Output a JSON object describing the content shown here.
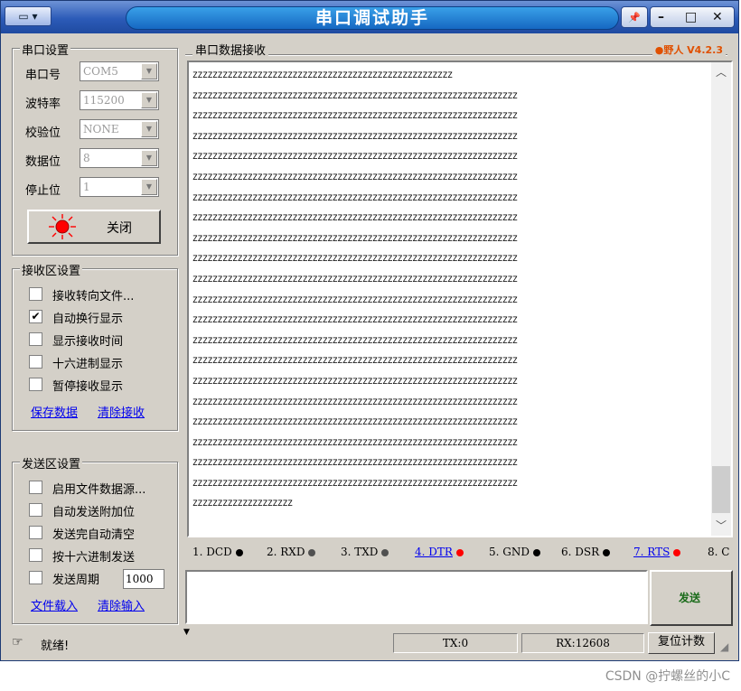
{
  "window": {
    "title": "串口调试助手",
    "sysmenu_icon": "window-menu-icon",
    "controls": {
      "pin": "📌",
      "minimize": "–",
      "maximize": "□",
      "close": "✕"
    }
  },
  "serial_settings": {
    "title": "串口设置",
    "fields": [
      {
        "label": "串口号",
        "value": "COM5"
      },
      {
        "label": "波特率",
        "value": "115200"
      },
      {
        "label": "校验位",
        "value": "NONE"
      },
      {
        "label": "数据位",
        "value": "8"
      },
      {
        "label": "停止位",
        "value": "1"
      }
    ],
    "open_button": "关闭",
    "indicator_color": "#ff0000"
  },
  "receive_settings": {
    "title": "接收区设置",
    "options": [
      {
        "label": "接收转向文件...",
        "checked": false
      },
      {
        "label": "自动换行显示",
        "checked": true
      },
      {
        "label": "显示接收时间",
        "checked": false
      },
      {
        "label": "十六进制显示",
        "checked": false
      },
      {
        "label": "暂停接收显示",
        "checked": false
      }
    ],
    "save_link": "保存数据",
    "clear_link": "清除接收"
  },
  "send_settings": {
    "title": "发送区设置",
    "options": [
      {
        "label": "启用文件数据源...",
        "checked": false
      },
      {
        "label": "自动发送附加位",
        "checked": false
      },
      {
        "label": "发送完自动清空",
        "checked": false
      },
      {
        "label": "按十六进制发送",
        "checked": false
      },
      {
        "label": "发送周期",
        "checked": false
      }
    ],
    "period_value": "1000",
    "load_link": "文件载入",
    "clear_link": "清除输入"
  },
  "receive_area": {
    "title": "串口数据接收",
    "brand": "●野人 V4.2.3",
    "brand_color": "#e05000",
    "first_line": "ZZZZZZZZZZZZZZZZZZZZZZZZZZZZZZZZZZZZZZZZZZZZZZZZZZZZ",
    "full_line": "ZZZZZZZZZZZZZZZZZZZZZZZZZZZZZZZZZZZZZZZZZZZZZZZZZZZZZZZZZZZZZZZZZ",
    "full_line_count": 20,
    "last_line": "ZZZZZZZZZZZZZZZZZZZZ"
  },
  "signals": [
    {
      "label": "1. DCD",
      "dot": "#000000",
      "link": false
    },
    {
      "label": "2. RXD",
      "dot": "#505050",
      "link": false
    },
    {
      "label": "3. TXD",
      "dot": "#505050",
      "link": false
    },
    {
      "label": "4. DTR",
      "dot": "#ff0000",
      "link": true
    },
    {
      "label": "5. GND",
      "dot": "#000000",
      "link": false
    },
    {
      "label": "6. DSR",
      "dot": "#000000",
      "link": false
    },
    {
      "label": "7. RTS",
      "dot": "#ff0000",
      "link": true
    },
    {
      "label": "8. C",
      "dot": "",
      "link": false
    }
  ],
  "send_button": "发送",
  "status": {
    "icon": "hand-pointer-icon",
    "text": "就绪!",
    "tx": "TX:0",
    "rx": "RX:12608",
    "reset": "复位计数"
  },
  "watermark": "CSDN @拧螺丝的小C"
}
